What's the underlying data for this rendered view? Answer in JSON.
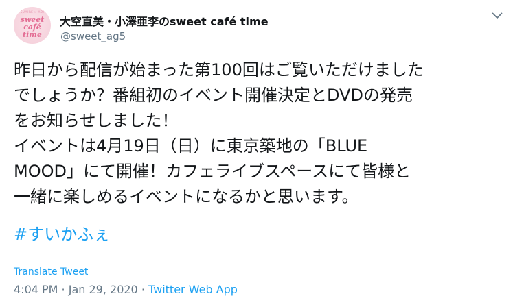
{
  "tweet": {
    "avatar": {
      "small_text": "SUMIRE × AOI",
      "line1": "sweet",
      "line2": "café",
      "line3": "time"
    },
    "display_name": "大空直美・小澤亜李のsweet café time",
    "handle": "@sweet_ag5",
    "body": "昨日から配信が始まった第100回はご覧いただけました\nでしょうか？番組初のイベント開催決定とDVDの発売\nをお知らせしました！\nイベントは4月19日（日）に東京築地の「BLUE\nMOOD」にて開催！カフェライブスペースにて皆様と\n一緒に楽しめるイベントになるかと思います。",
    "hashtag": "#すいかふぇ",
    "translate_label": "Translate Tweet",
    "time": "4:04 PM",
    "separator1": " · ",
    "date": "Jan 29, 2020",
    "separator2": " · ",
    "source": "Twitter Web App"
  },
  "colors": {
    "link": "#1da1f2",
    "secondary": "#657786",
    "text": "#14171a",
    "avatar_bg": "#f6d3dd",
    "avatar_text": "#e36c93"
  },
  "icons": {
    "menu": "chevron-down-icon"
  }
}
